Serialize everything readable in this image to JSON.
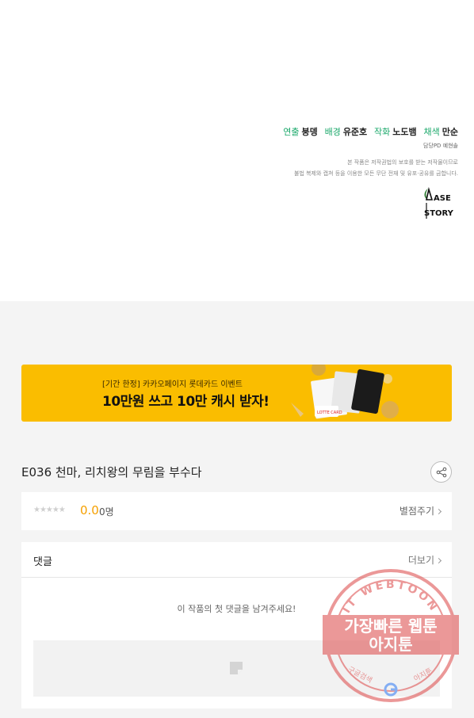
{
  "credits": {
    "line": [
      {
        "role": "연출",
        "name": "붕뎅"
      },
      {
        "role": "배경",
        "name": "유준호"
      },
      {
        "role": "작화",
        "name": "노도뱀"
      },
      {
        "role": "채색",
        "name": "만순"
      }
    ],
    "pd": "담당PD 예현솔",
    "notice_line1": "본 작품은 저작권법의 보호를 받는 저작물이므로",
    "notice_line2": "불법 복제와 캡쳐 등을 이용한 모든 무단 전재 및 유포·공유를 금합니다.",
    "logo_text_top": "ASE",
    "logo_text_bottom": "STORY"
  },
  "banner": {
    "small_text": "[기간 한정] 카카오페이지 롯데카드 이벤트",
    "big_text": "10만원 쓰고 10만 캐시 받자!",
    "card_label": "LOTTE CARD",
    "color": "#fabd00"
  },
  "episode": {
    "title": "E036 천마, 리치왕의 무림을 부수다",
    "share_icon": "share-icon"
  },
  "rating": {
    "stars": "★★★★★",
    "score": "0.0",
    "count": "0명",
    "rate_label": "별점주기"
  },
  "comments": {
    "title": "댓글",
    "more_label": "더보기",
    "empty_message": "이 작품의 첫 댓글을 남겨주세요!"
  },
  "watermark": {
    "arc_text": "AGIT WEBTOON",
    "line1": "가장빠른 웹툰",
    "line2": "아지툰",
    "bottom_left": "구글검색",
    "bottom_right": "아지툰",
    "color": "#e05a5a"
  }
}
